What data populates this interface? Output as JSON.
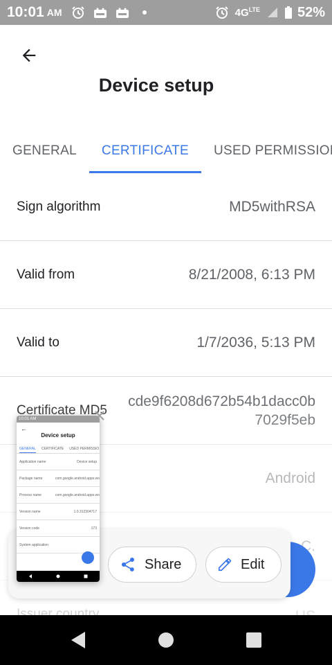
{
  "status": {
    "time": "10:01",
    "ampm": "AM",
    "network": "4G",
    "network_sup": "LTE",
    "battery": "52%",
    "icons": [
      "alarm-icon",
      "apk-icon",
      "apk-icon",
      "dot-icon",
      "alarm-icon",
      "signal-icon",
      "battery-icon"
    ]
  },
  "appbar": {
    "title": "Device setup",
    "back_icon": "arrow-back-icon"
  },
  "tabs": [
    {
      "label": "GENERAL",
      "active": false
    },
    {
      "label": "CERTIFICATE",
      "active": true
    },
    {
      "label": "USED PERMISSIONS",
      "active": false
    }
  ],
  "rows": [
    {
      "label": "Sign algorithm",
      "value": "MD5withRSA"
    },
    {
      "label": "Valid from",
      "value": "8/21/2008, 6:13 PM"
    },
    {
      "label": "Valid to",
      "value": "1/7/2036, 5:13 PM"
    },
    {
      "label": "Certificate MD5",
      "value": "cde9f6208d672b54b1dacc0b7029f5eb"
    },
    {
      "label": "",
      "value": "Android"
    },
    {
      "label": "",
      "value": "C."
    },
    {
      "label": "Issuer country",
      "value": "US"
    }
  ],
  "screenshot_preview": {
    "title": "Device setup",
    "tabs": [
      "GENERAL",
      "CERTIFICATE",
      "USED PERMISSIO"
    ],
    "rows": [
      {
        "label": "Application name",
        "value": "Device setup"
      },
      {
        "label": "Package name",
        "value": "com.google.android.apps.work.oobconfig"
      },
      {
        "label": "Process name",
        "value": "com.google.android.apps.work.oobconfig"
      },
      {
        "label": "Version name",
        "value": "1.0.312304717"
      },
      {
        "label": "Version code",
        "value": "173"
      },
      {
        "label": "System application",
        "value": ""
      }
    ]
  },
  "share_panel": {
    "share_label": "Share",
    "edit_label": "Edit"
  },
  "colors": {
    "accent": "#3b78e7",
    "status_bar": "#9e9e9e",
    "text_primary": "#202124",
    "text_secondary": "#5f6368"
  }
}
